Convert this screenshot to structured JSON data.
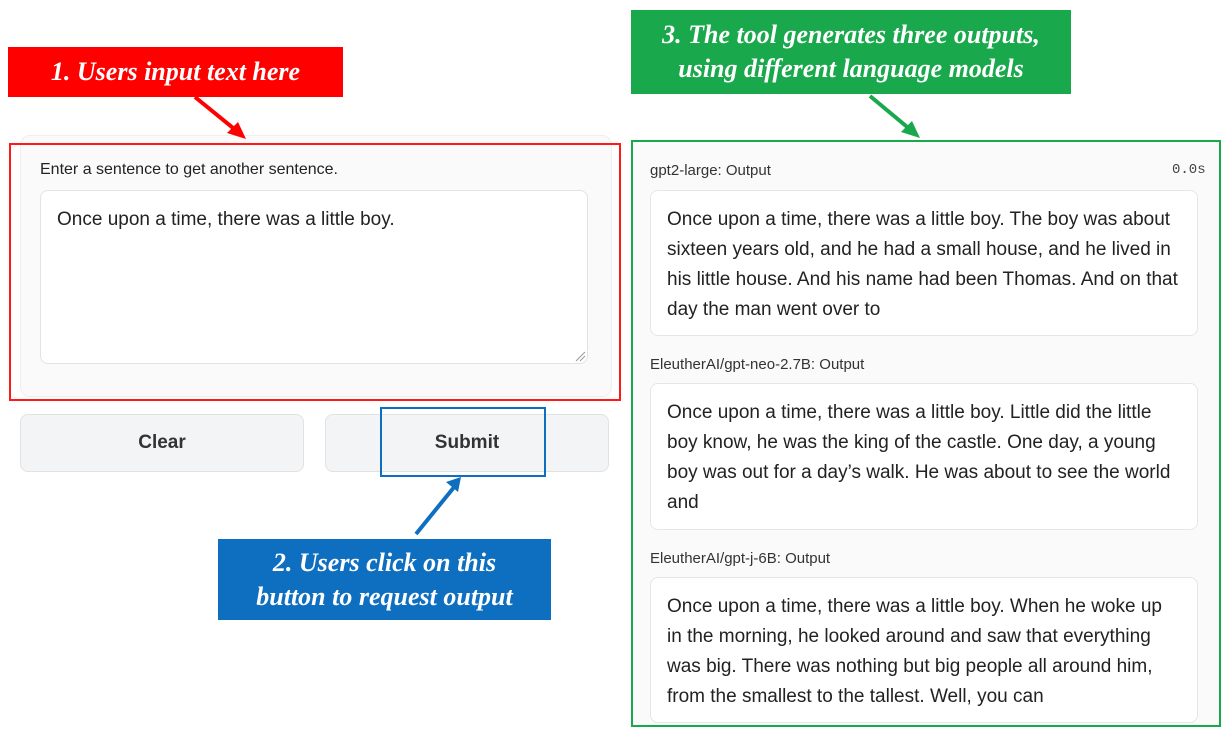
{
  "annotations": {
    "step1": "1. Users input text here",
    "step2": [
      "2. Users click on this",
      "button to request output"
    ],
    "step3": [
      "3. The tool generates three outputs,",
      "using different language models"
    ],
    "colors": {
      "step1": "#ff0000",
      "step2": "#0e6ec0",
      "step3": "#1aa84c"
    }
  },
  "input": {
    "label": "Enter a sentence to get another sentence.",
    "value": "Once upon a time, there was a little boy."
  },
  "buttons": {
    "clear": "Clear",
    "submit": "Submit"
  },
  "outputs": {
    "timer": "0.0s",
    "items": [
      {
        "label": "gpt2-large: Output",
        "text": "Once upon a time, there was a little boy. The boy was about sixteen years old, and he had a small house, and he lived in his little house. And his name had been Thomas. And on that day the man went over to"
      },
      {
        "label": "EleutherAI/gpt-neo-2.7B: Output",
        "text": "Once upon a time, there was a little boy. Little did the little boy know, he was the king of the castle. One day, a young boy was out for a day’s walk. He was about to see the world and"
      },
      {
        "label": "EleutherAI/gpt-j-6B: Output",
        "text": "Once upon a time, there was a little boy. When he woke up in the morning, he looked around and saw that everything was big. There was nothing but big people all around him, from the smallest to the tallest. Well, you can"
      }
    ]
  }
}
